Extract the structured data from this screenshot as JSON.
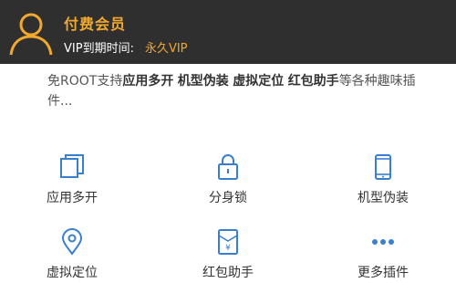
{
  "header": {
    "title": "付费会员",
    "vip_label": "VIP到期时间:",
    "vip_value": "永久VIP"
  },
  "description": {
    "prefix": "免ROOT支持",
    "features": [
      "应用多开",
      "机型伪装",
      "虚拟定位",
      "红包助手"
    ],
    "suffix": "等各种趣味插件..."
  },
  "features_grid": [
    {
      "label": "应用多开",
      "icon": "multi-app-icon"
    },
    {
      "label": "分身锁",
      "icon": "lock-icon"
    },
    {
      "label": "机型伪装",
      "icon": "phone-icon"
    },
    {
      "label": "虚拟定位",
      "icon": "location-pin-icon"
    },
    {
      "label": "红包助手",
      "icon": "red-envelope-icon"
    },
    {
      "label": "更多插件",
      "icon": "more-dots-icon"
    }
  ],
  "colors": {
    "header_bg": "#2f2f2f",
    "accent": "#f0a92e",
    "icon_blue": "#3a7fcf"
  }
}
